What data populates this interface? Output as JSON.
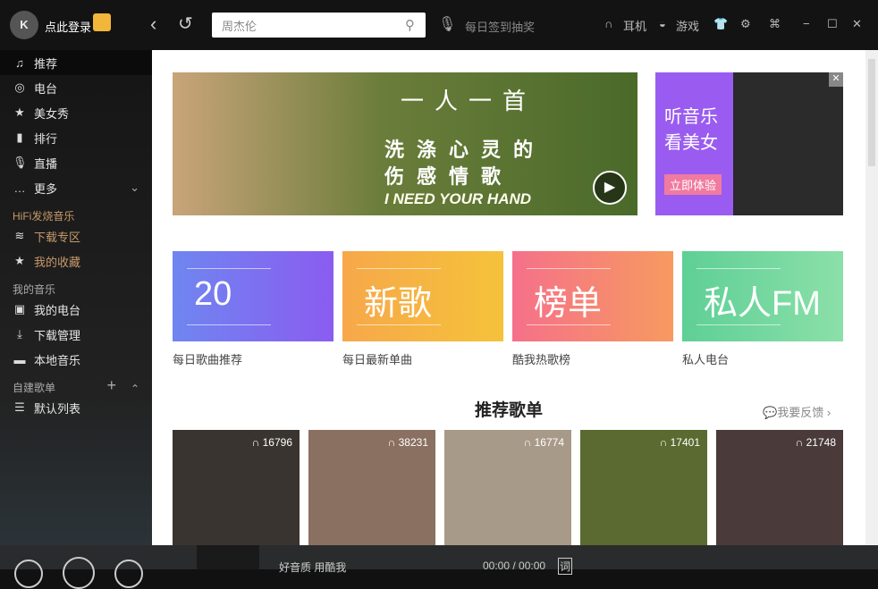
{
  "header": {
    "login": "点此登录",
    "search_value": "周杰伦",
    "sign_in": "每日签到抽奖",
    "headphone": "耳机",
    "game": "游戏"
  },
  "sidebar": {
    "items": [
      {
        "label": "推荐",
        "icon": "music-note-icon"
      },
      {
        "label": "电台",
        "icon": "radio-icon"
      },
      {
        "label": "美女秀",
        "icon": "star-icon"
      },
      {
        "label": "排行",
        "icon": "chart-icon"
      },
      {
        "label": "直播",
        "icon": "mic-icon"
      },
      {
        "label": "更多",
        "icon": "more-icon"
      }
    ],
    "hifi_title": "HiFi发烧音乐",
    "hifi_items": [
      {
        "label": "下载专区"
      },
      {
        "label": "我的收藏"
      }
    ],
    "my_music_title": "我的音乐",
    "my_music_items": [
      {
        "label": "我的电台"
      },
      {
        "label": "下载管理"
      },
      {
        "label": "本地音乐"
      }
    ],
    "playlist_title": "自建歌单",
    "playlists": [
      {
        "label": "默认列表"
      }
    ]
  },
  "banner": {
    "line1": "一人一首",
    "line2": "洗涤心灵的",
    "line3": "伤感情歌",
    "line4": "I NEED YOUR HAND"
  },
  "ad": {
    "line1": "听音乐",
    "line2": "看美女",
    "button": "立即体验"
  },
  "cards": [
    {
      "title": "20",
      "caption": "每日歌曲推荐",
      "color": "#7b74ee"
    },
    {
      "title": "新歌",
      "caption": "每日最新单曲",
      "color": "#f5b64a"
    },
    {
      "title": "榜单",
      "caption": "酷我热歌榜",
      "color": "#f07b7b"
    },
    {
      "title": "私人FM",
      "caption": "私人电台",
      "color": "#6fd39a"
    }
  ],
  "section": {
    "title": "推荐歌单",
    "feedback": "我要反馈"
  },
  "playlists": [
    {
      "plays": "16796"
    },
    {
      "plays": "38231"
    },
    {
      "plays": "16774"
    },
    {
      "plays": "17401"
    },
    {
      "plays": "21748"
    }
  ],
  "player": {
    "song": "好音质 用酷我",
    "time": "00:00 / 00:00",
    "lyric": "词"
  }
}
